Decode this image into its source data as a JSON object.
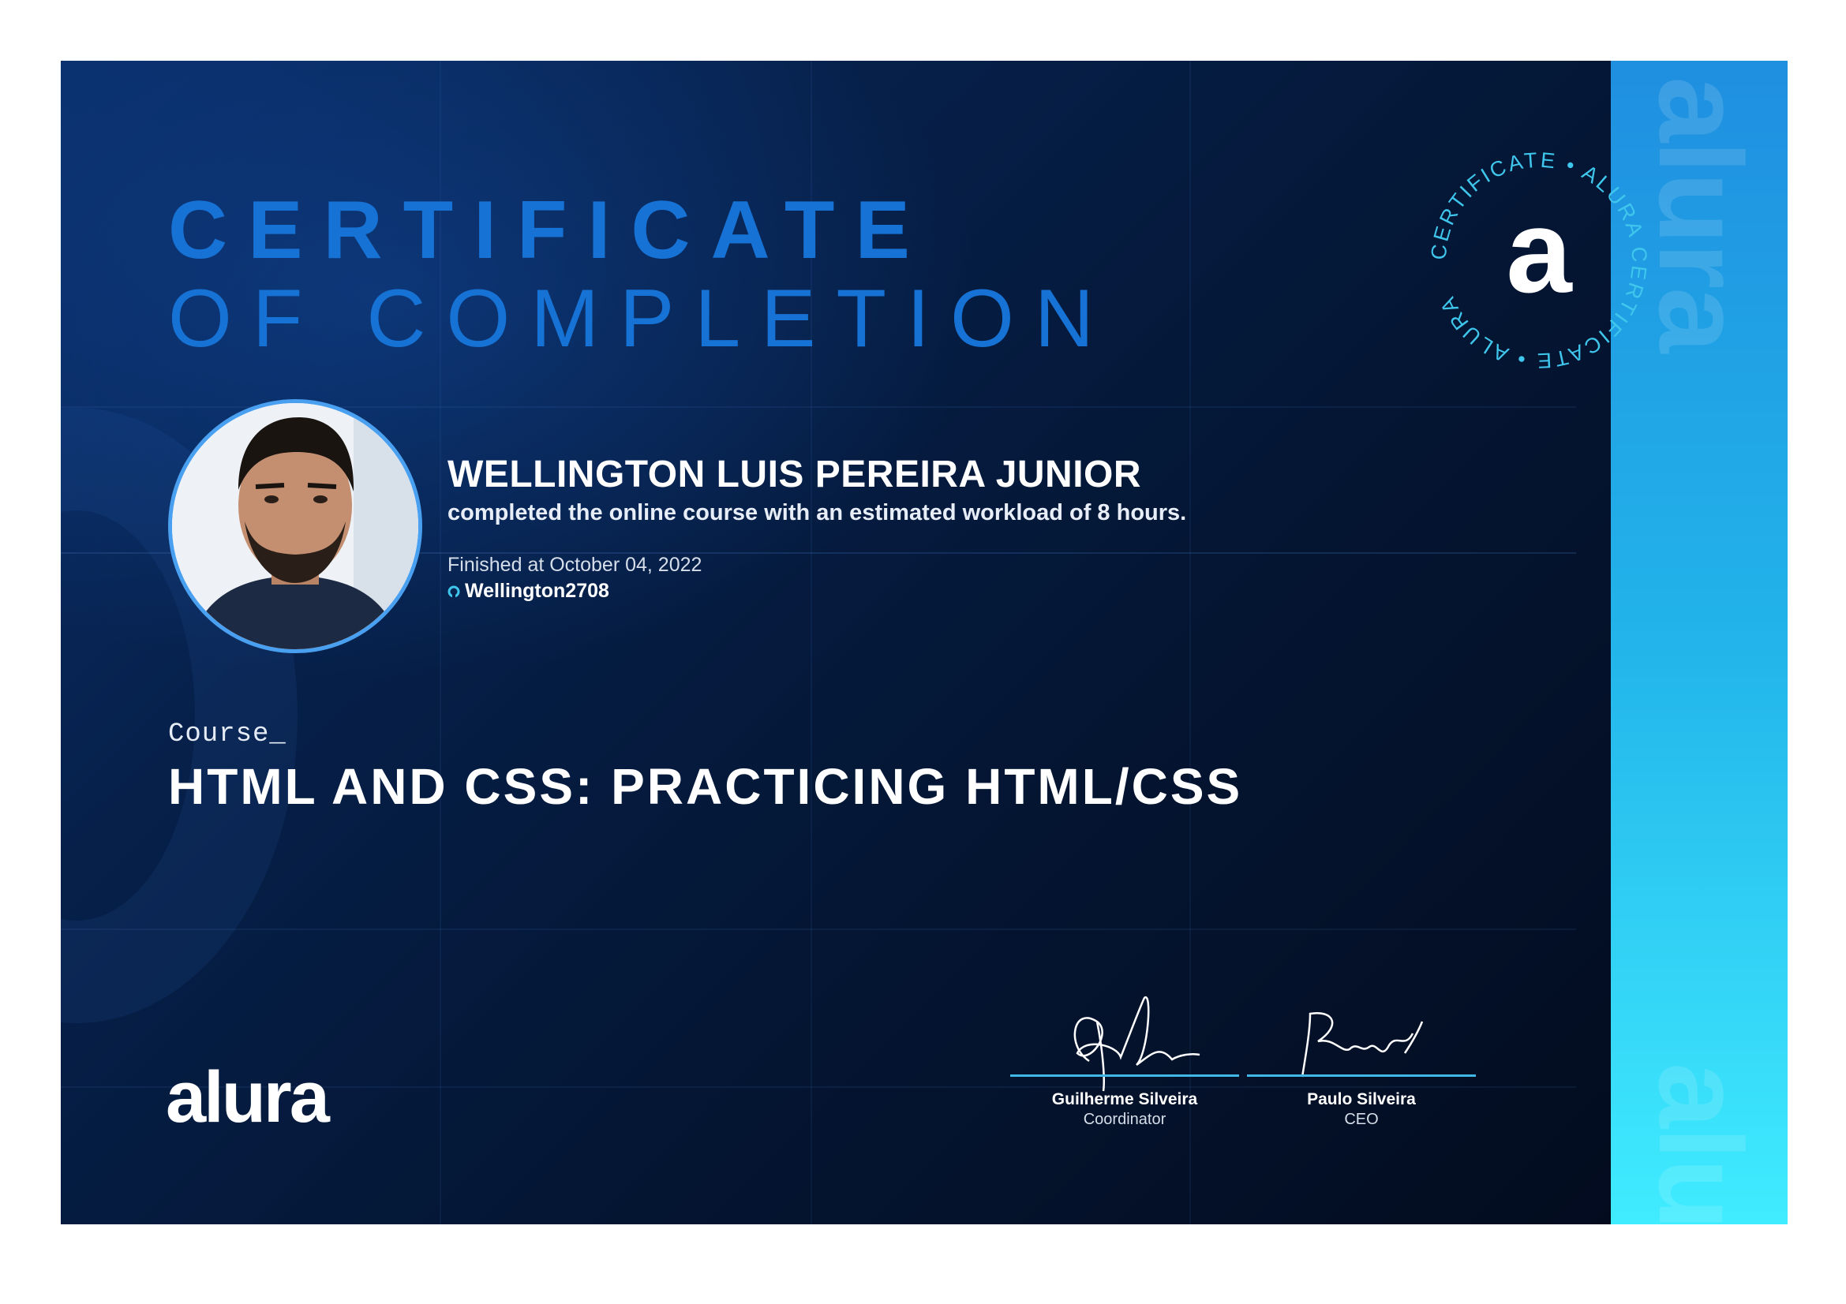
{
  "certificate": {
    "title_line1": "CERTIFICATE",
    "title_line2": "OF COMPLETION",
    "seal_text": "CERTIFICATE • ALURA CERTIFICATE • ALURA ",
    "seal_letter": "a",
    "side_watermark": "alura",
    "student": {
      "name": "WELLINGTON LUIS PEREIRA JUNIOR",
      "description": "completed the online course with an estimated workload of 8 hours.",
      "finished": "Finished at October 04, 2022",
      "username": "Wellington2708",
      "username_icon": "github-icon"
    },
    "course": {
      "label": "Course_",
      "title": "HTML AND CSS: PRACTICING HTML/CSS"
    },
    "logo_text": "alura",
    "signatures": [
      {
        "name": "Guilherme Silveira",
        "role": "Coordinator"
      },
      {
        "name": "Paulo Silveira",
        "role": "CEO"
      }
    ],
    "colors": {
      "accent": "#1672d4",
      "side_top": "#1f8fe0",
      "side_bottom": "#40ecff",
      "background": "#041634"
    }
  }
}
